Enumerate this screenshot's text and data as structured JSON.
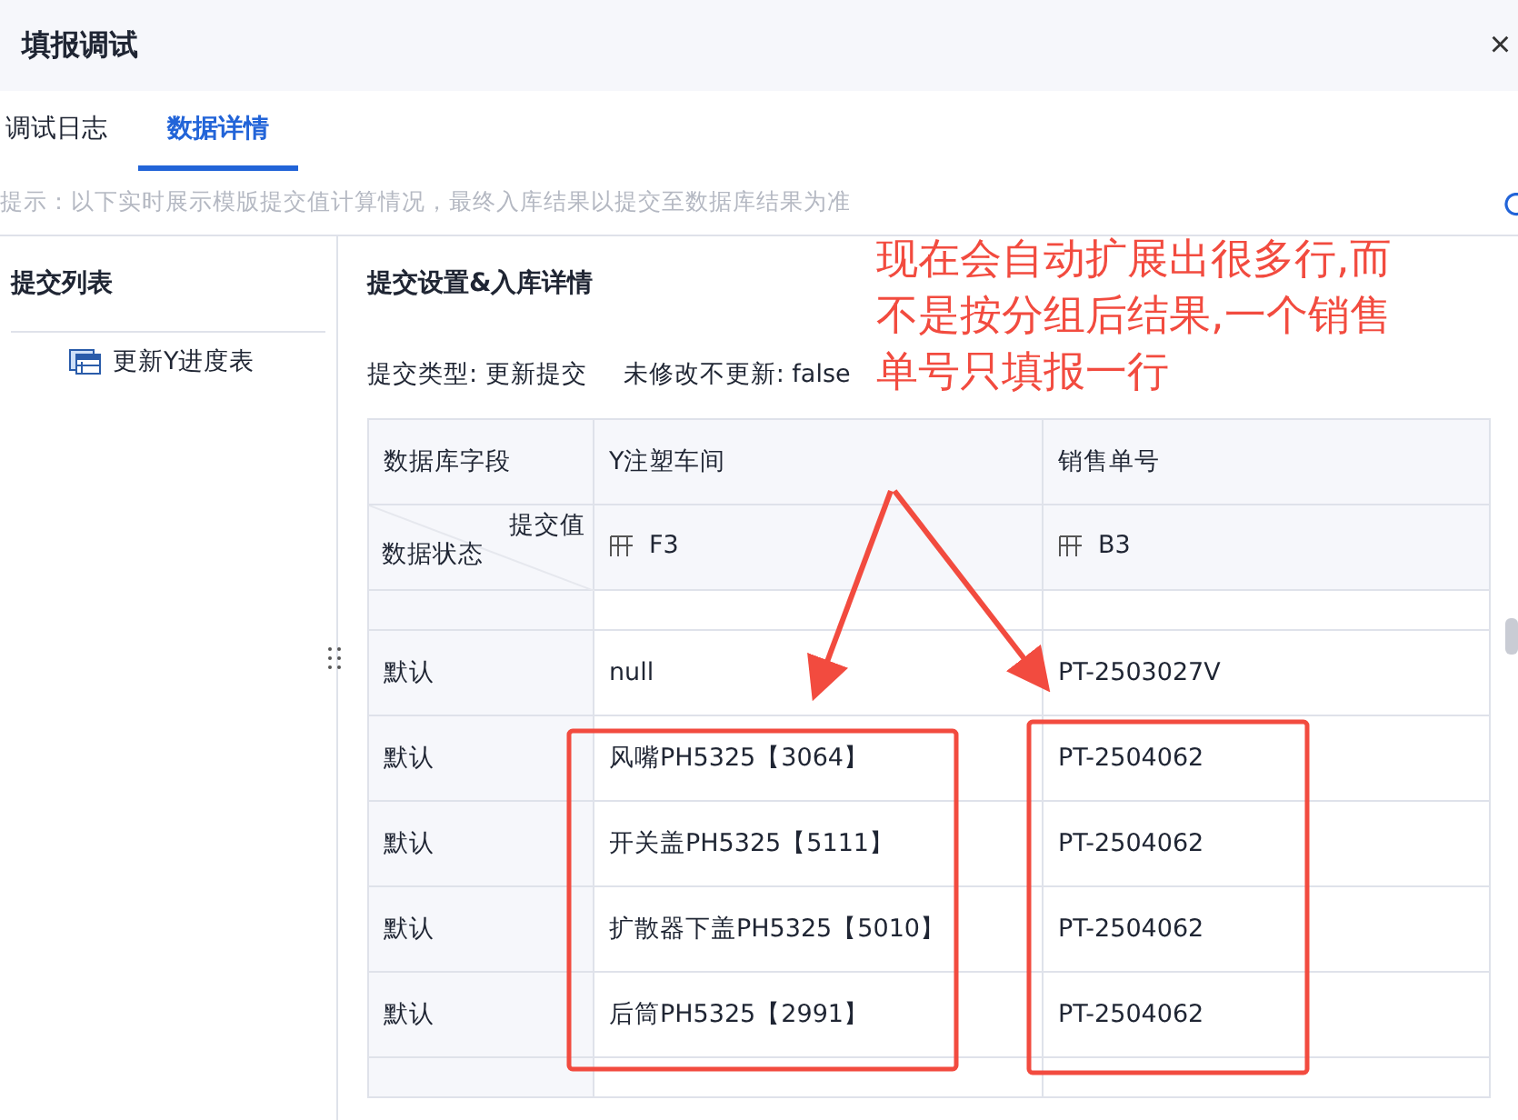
{
  "window": {
    "title": "填报调试",
    "close": "×"
  },
  "tabs": [
    {
      "label": "调试日志",
      "selected": false
    },
    {
      "label": "数据详情",
      "selected": true
    }
  ],
  "hint": "提示：以下实时展示模版提交值计算情况，最终入库结果以提交至数据库结果为准",
  "sidebar": {
    "title": "提交列表",
    "items": [
      {
        "label": "更新Y进度表",
        "selected": false
      }
    ]
  },
  "detail": {
    "title": "提交设置&入库详情",
    "submit_type": "提交类型: 更新提交",
    "no_update": "未修改不更新: false"
  },
  "table": {
    "columns": [
      "数据库字段",
      "Y注塑车间",
      "销售单号"
    ],
    "subheader": [
      {
        "kind": "corner",
        "top": "提交值",
        "bottom": "数据状态"
      },
      {
        "kind": "ref",
        "text": "F3"
      },
      {
        "kind": "ref",
        "text": "B3"
      }
    ],
    "rows": [
      [
        "默认",
        "null",
        "PT-2503027V"
      ],
      [
        "默认",
        "风嘴PH5325【3064】",
        "PT-2504062"
      ],
      [
        "默认",
        "开关盖PH5325【5111】",
        "PT-2504062"
      ],
      [
        "默认",
        "扩散器下盖PH5325【5010】",
        "PT-2504062"
      ],
      [
        "默认",
        "后筒PH5325【2991】",
        "PT-2504062"
      ]
    ]
  },
  "annotation": {
    "lines": [
      "现在会自动扩展出很多行,而",
      "不是按分组后结果,一个销售",
      "单号只填报一行"
    ]
  }
}
